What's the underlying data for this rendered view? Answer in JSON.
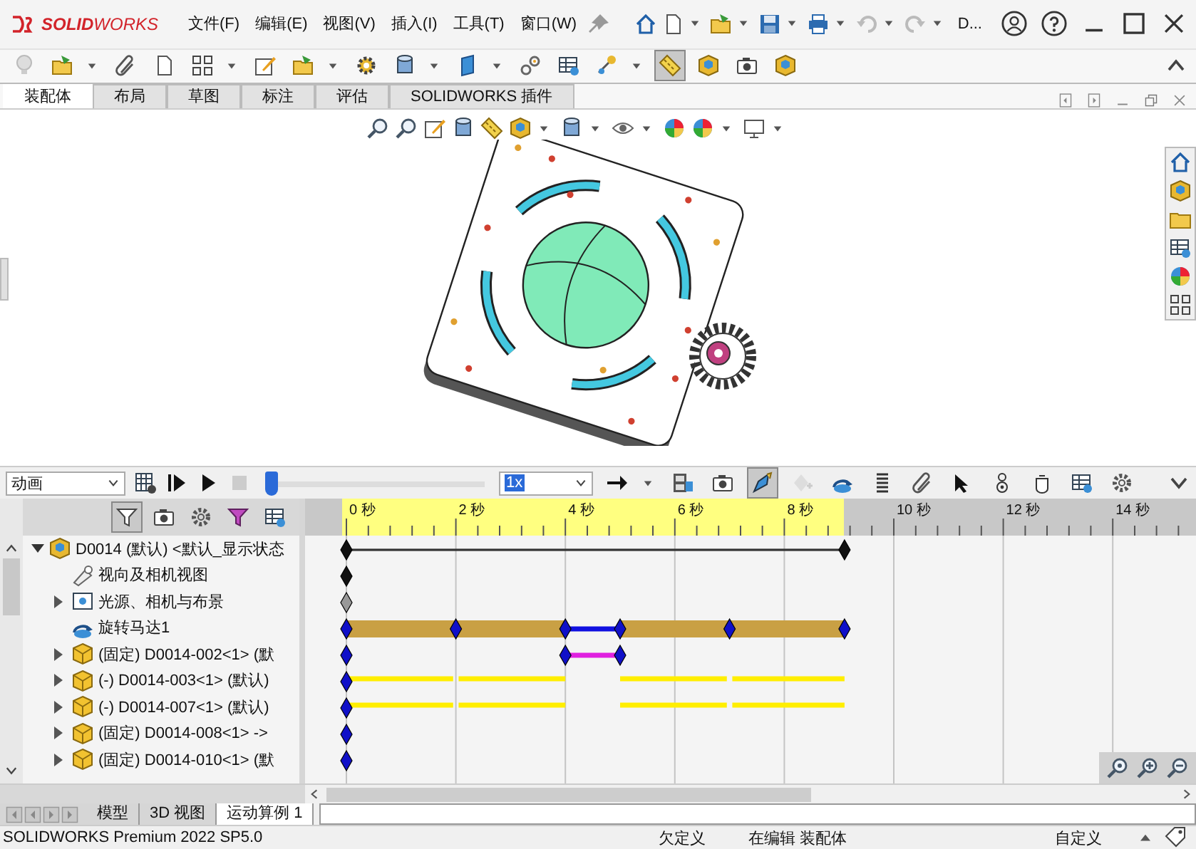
{
  "title_bar": {
    "logo": "**SOLID**WORKS",
    "menus": [
      "文件(F)",
      "编辑(E)",
      "视图(V)",
      "插入(I)",
      "工具(T)",
      "窗口(W)"
    ],
    "document": "D..."
  },
  "main_toolbar": {
    "buttons": [
      {
        "pressed": false
      },
      {
        "pressed": false
      },
      {
        "pressed": false
      },
      {
        "pressed": false
      },
      {
        "pressed": false
      },
      {
        "pressed": false
      },
      {
        "pressed": false
      },
      {
        "pressed": false
      },
      {
        "pressed": false
      },
      {
        "pressed": false
      },
      {
        "pressed": false
      },
      {
        "pressed": false
      },
      {
        "pressed": false
      },
      {
        "pressed": true
      },
      {
        "pressed": false
      },
      {
        "pressed": false
      },
      {
        "pressed": false
      }
    ]
  },
  "command_tabs": [
    {
      "label": "装配体",
      "selected": true
    },
    {
      "label": "布局",
      "selected": false
    },
    {
      "label": "草图",
      "selected": false
    },
    {
      "label": "标注",
      "selected": false
    },
    {
      "label": "评估",
      "selected": false
    },
    {
      "label": "SOLIDWORKS 插件",
      "selected": false
    }
  ],
  "motion_toolbar": {
    "study_type": "动画",
    "slider": {
      "level": 0
    },
    "speed": "1x",
    "buttons": [
      {
        "pressed": false
      },
      {
        "pressed": false
      },
      {
        "pressed": false
      },
      {
        "pressed": true
      },
      {
        "pressed": false
      },
      {
        "pressed": false
      },
      {
        "pressed": false
      },
      {
        "pressed": false
      },
      {
        "pressed": false
      },
      {
        "pressed": false
      },
      {
        "pressed": false
      },
      {
        "pressed": false
      },
      {
        "pressed": false
      }
    ]
  },
  "filter_buttons": [
    {
      "pressed": true
    },
    {
      "pressed": false
    },
    {
      "pressed": false
    },
    {
      "pressed": false
    },
    {
      "pressed": false
    }
  ],
  "timeline": {
    "ruler": [
      "0 秒",
      "2 秒",
      "4 秒",
      "6 秒",
      "8 秒",
      "10 秒",
      "12 秒",
      "14 秒"
    ]
  },
  "tree": {
    "label": "D0014 (默认) <默认_显示状态",
    "kind": "assembly",
    "expanded": true,
    "children": [
      {
        "label": "视向及相机视图",
        "kind": "camera",
        "expandable": false
      },
      {
        "label": "光源、相机与布景",
        "kind": "lights",
        "expandable": true,
        "expanded": false
      },
      {
        "label": "旋转马达1",
        "kind": "motor",
        "expandable": false
      },
      {
        "label": "(固定) D0014-002<1> (默",
        "kind": "driven",
        "expandable": true,
        "expanded": false
      },
      {
        "label": "(-) D0014-003<1> (默认)",
        "kind": "moving",
        "expandable": true,
        "expanded": false
      },
      {
        "label": "(-) D0014-007<1> (默认)",
        "kind": "moving",
        "expandable": true,
        "expanded": false
      },
      {
        "label": "(固定) D0014-008<1> ->",
        "kind": "fixed",
        "expandable": true,
        "expanded": false
      },
      {
        "label": "(固定) D0014-010<1> (默",
        "kind": "fixed",
        "expandable": true,
        "expanded": false
      }
    ]
  },
  "bottom_tabs": [
    {
      "label": "模型",
      "selected": false
    },
    {
      "label": "3D 视图",
      "selected": false
    },
    {
      "label": "运动算例 1",
      "selected": true
    }
  ],
  "status_bar": {
    "product": "SOLIDWORKS Premium 2022 SP5.0",
    "state": "欠定义",
    "mode": "在编辑 装配体",
    "units": "自定义"
  }
}
